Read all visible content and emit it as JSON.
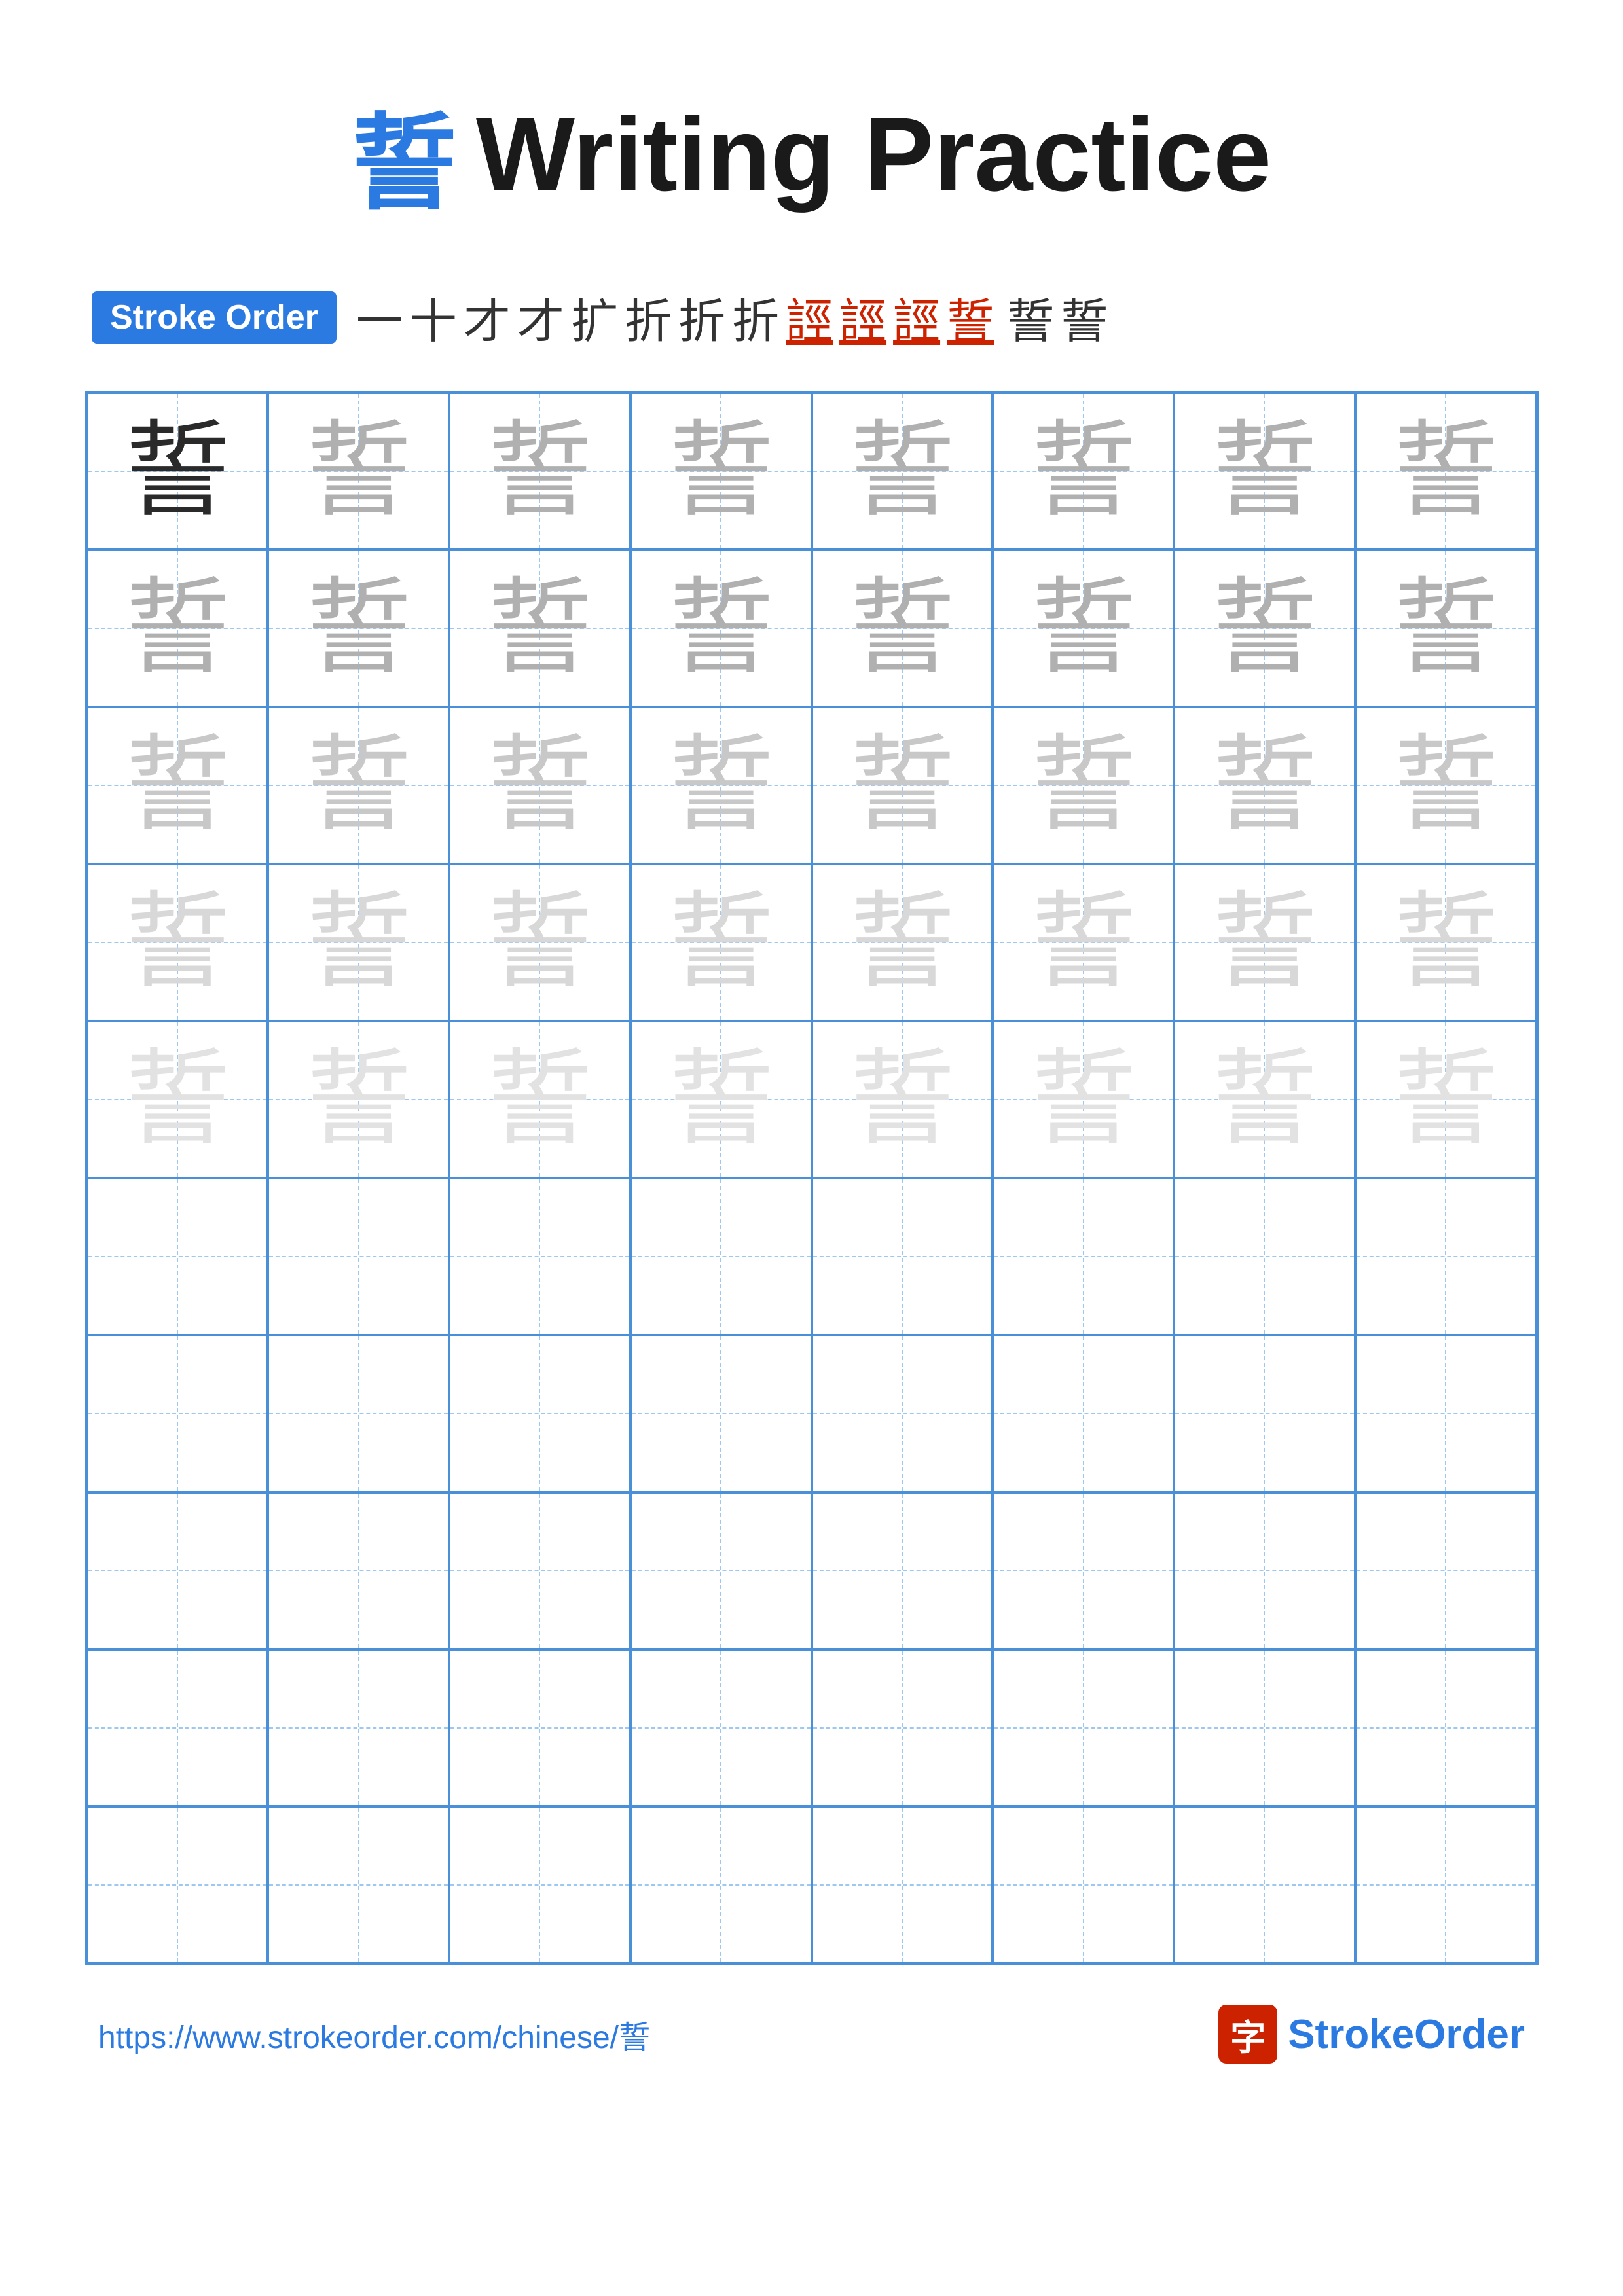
{
  "title": {
    "char": "誓",
    "text": "Writing Practice"
  },
  "strokeOrder": {
    "badgeLabel": "Stroke Order",
    "strokes": [
      {
        "char": "一",
        "style": "normal"
      },
      {
        "char": "十",
        "style": "normal"
      },
      {
        "char": "才",
        "style": "normal"
      },
      {
        "char": "扌",
        "style": "normal"
      },
      {
        "char": "扩",
        "style": "normal"
      },
      {
        "char": "折",
        "style": "normal"
      },
      {
        "char": "折",
        "style": "normal"
      },
      {
        "char": "折",
        "style": "normal"
      },
      {
        "char": "誙",
        "style": "red-underline"
      },
      {
        "char": "誙",
        "style": "red-underline"
      },
      {
        "char": "誙",
        "style": "red-underline"
      },
      {
        "char": "誓",
        "style": "red-underline"
      },
      {
        "char": "誓",
        "style": "normal"
      },
      {
        "char": "誓",
        "style": "normal"
      }
    ]
  },
  "grid": {
    "rows": 10,
    "cols": 8,
    "char": "誓",
    "filledRows": 5,
    "colorLevels": [
      "dark",
      "light1",
      "light2",
      "light3",
      "light4"
    ]
  },
  "footer": {
    "url": "https://www.strokeorder.com/chinese/誓",
    "logoChar": "字",
    "brandName": "StrokeOrder"
  }
}
